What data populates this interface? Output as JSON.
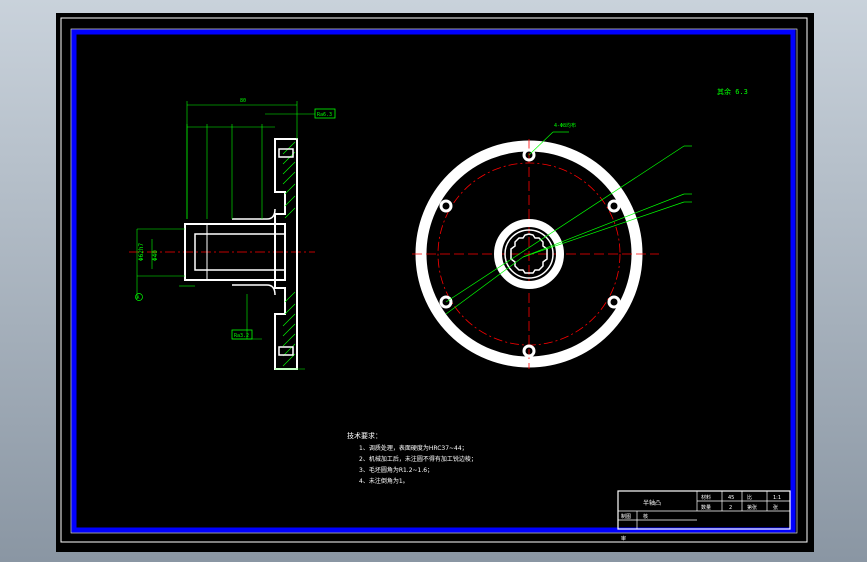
{
  "drawing": {
    "roughness_note": "其余 6.3",
    "technical_requirements": {
      "title": "技术要求：",
      "items": [
        "1、调质处理，表面硬度为HRC37~44；",
        "2、机械加工后，未注圆不得有加工锐边棱；",
        "3、毛坯圆角为R1.2~1.6；",
        "4、未注倒角为1。"
      ]
    },
    "title_block": {
      "part_name": "半轴凸",
      "material_label": "材料",
      "material_value": "45",
      "scale_label": "比",
      "scale_value": "1:1",
      "qty_label": "数量",
      "qty_value": "2",
      "sheet_label": "第张",
      "sheet_value": "张",
      "drawn_label": "制图",
      "check_label": "核",
      "bottom_label": "审"
    },
    "section_labels": {
      "top_dim": "80",
      "tag_top": "Ra6.3",
      "hole_tag": "4-Φ8均布",
      "center_dia": "Φ40",
      "left_dia": "Φ62h7",
      "tag_bottom": "Ra3.2",
      "datum": "A"
    },
    "colors": {
      "frame_blue": "#0000ff",
      "outline_white": "#ffffff",
      "dim_green": "#00ff00",
      "center_red": "#ff0000"
    }
  }
}
